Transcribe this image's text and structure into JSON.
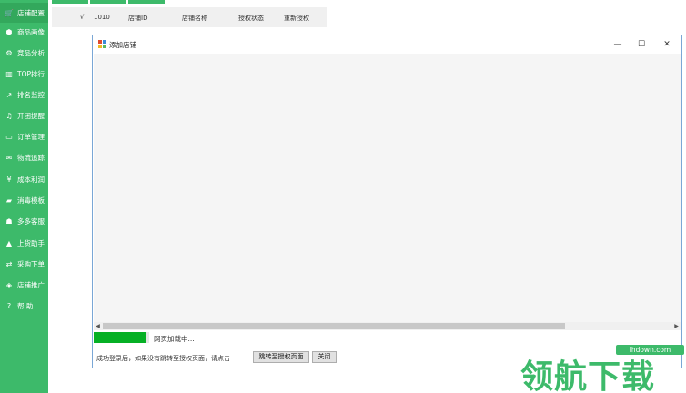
{
  "sidebar": {
    "items": [
      {
        "icon": "cart-icon",
        "glyph": "🛒",
        "label": "店铺配置",
        "active": true
      },
      {
        "icon": "box-icon",
        "glyph": "⬢",
        "label": "商品画像"
      },
      {
        "icon": "analysis-icon",
        "glyph": "⚙",
        "label": "竞品分析"
      },
      {
        "icon": "bar-chart-icon",
        "glyph": "▥",
        "label": "TOP排行"
      },
      {
        "icon": "trend-icon",
        "glyph": "↗",
        "label": "排名监控"
      },
      {
        "icon": "bell-icon",
        "glyph": "♫",
        "label": "开团提醒"
      },
      {
        "icon": "folder-icon",
        "glyph": "▭",
        "label": "订单管理"
      },
      {
        "icon": "mail-icon",
        "glyph": "✉",
        "label": "物流追踪"
      },
      {
        "icon": "yen-icon",
        "glyph": "¥",
        "label": "成本利润"
      },
      {
        "icon": "book-icon",
        "glyph": "▰",
        "label": "消毒模板"
      },
      {
        "icon": "users-icon",
        "glyph": "☗",
        "label": "多多客服"
      },
      {
        "icon": "car-icon",
        "glyph": "▲",
        "label": "上货助手"
      },
      {
        "icon": "transfer-icon",
        "glyph": "⇄",
        "label": "采购下单"
      },
      {
        "icon": "car2-icon",
        "glyph": "◈",
        "label": "店铺推广"
      },
      {
        "icon": "help-icon",
        "glyph": "?",
        "label": "帮  助"
      }
    ]
  },
  "table": {
    "check": "√",
    "number": "1010",
    "headers": [
      "店铺ID",
      "店铺名称",
      "授权状态",
      "重新授权"
    ]
  },
  "dialog": {
    "title": "添加店铺",
    "controls": {
      "minimize": "—",
      "maximize": "☐",
      "close": "✕"
    },
    "progress": 0.95,
    "progress_color": "#06b025",
    "loading_text": "网页加载中...",
    "hint": "成功登录后，如果没有跳转至授权页面，请点击",
    "jump_button": "跳转至授权页面",
    "close_button": "关闭",
    "scroll_left": "◀",
    "scroll_right": "▶"
  },
  "watermark": {
    "url": "lhdown.com",
    "text": "领航下载"
  },
  "colors": {
    "sidebar": "#3dba6a",
    "accent": "#3dba6a"
  }
}
